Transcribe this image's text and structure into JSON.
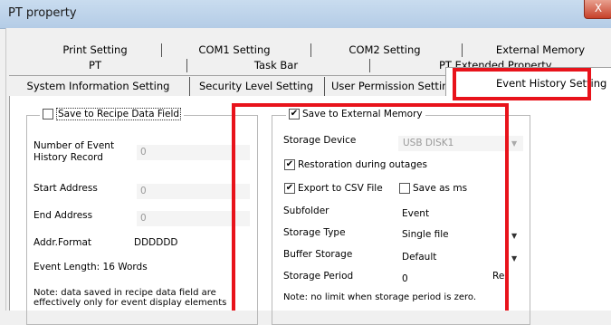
{
  "window": {
    "title": "PT property",
    "close_glyph": "X"
  },
  "tabs": {
    "row1": [
      "Print Setting",
      "COM1 Setting",
      "COM2 Setting",
      "External Memory"
    ],
    "row2": [
      "PT",
      "Task Bar",
      "PT Extended Property"
    ],
    "row3": [
      "System Information Setting",
      "Security Level Setting",
      "User Permission Setting",
      "Event History Setting"
    ]
  },
  "left_group": {
    "checkbox_label": "Save to Recipe Data Field",
    "checked": false,
    "number_label_1": "Number of Event",
    "number_label_2": "History Record",
    "number_value": "0",
    "start_label": "Start Address",
    "start_value": "0",
    "end_label": "End Address",
    "end_value": "0",
    "addr_label": "Addr.Format",
    "addr_value": "DDDDDD",
    "event_length": "Event Length: 16 Words",
    "note_1": "Note: data saved in recipe data field are",
    "note_2": "effectively only for event display elements"
  },
  "right_group": {
    "checkbox_label": "Save to External Memory",
    "checked": true,
    "device_label": "Storage Device",
    "device_value": "USB DISK1",
    "restoration_label": "Restoration during outages",
    "restoration_checked": true,
    "export_label": "Export to CSV File",
    "export_checked": true,
    "save_ms_label": "Save as ms",
    "save_ms_checked": false,
    "subfolder_label": "Subfolder",
    "subfolder_value": "Event",
    "type_label": "Storage Type",
    "type_value": "Single file",
    "buffer_label": "Buffer Storage",
    "buffer_value": "Default",
    "period_label": "Storage Period",
    "period_value": "0",
    "period_suffix": "Re",
    "note": "Note: no limit when storage period is zero."
  },
  "colors": {
    "highlight": "#e8131b",
    "titlebar": "#c9dcef"
  }
}
